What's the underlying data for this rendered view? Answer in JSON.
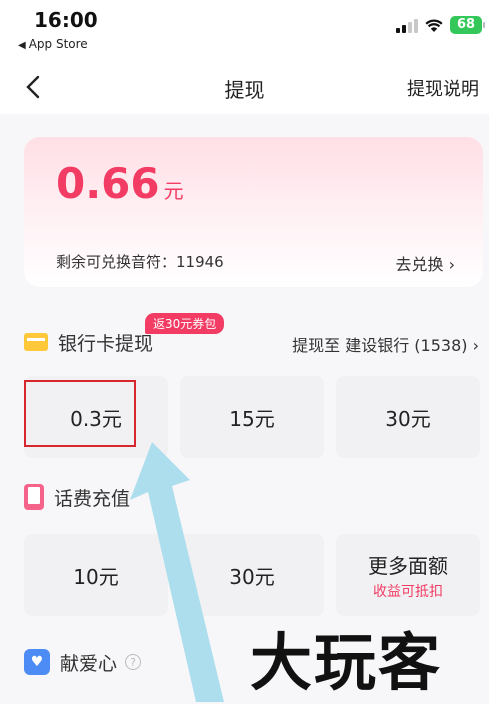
{
  "status": {
    "time": "16:00",
    "back_app": "App Store",
    "battery": "68"
  },
  "nav": {
    "title": "提现",
    "help": "提现说明"
  },
  "balance": {
    "amount": "0.66",
    "unit": "元",
    "remaining_label": "剩余可兑换音符：11946",
    "exchange": "去兑换 ›"
  },
  "bank": {
    "title": "银行卡提现",
    "badge": "返30元券包",
    "target": "提现至 建设银行 (1538) ›",
    "options": [
      "0.3元",
      "15元",
      "30元"
    ]
  },
  "phone": {
    "title": "话费充值",
    "options": [
      {
        "value": "10元",
        "sub": ""
      },
      {
        "value": "30元",
        "sub": ""
      },
      {
        "value": "更多面额",
        "sub": "收益可抵扣"
      }
    ]
  },
  "charity": {
    "title": "献爱心",
    "help": "?"
  },
  "watermark": "大玩客",
  "colors": {
    "accent": "#f23c63",
    "highlight": "#d8262e",
    "arrow": "#a9dcec"
  }
}
